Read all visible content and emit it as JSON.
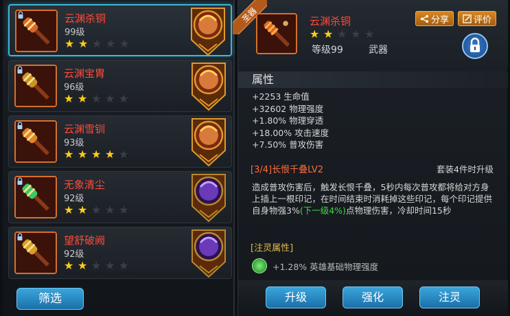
{
  "items": [
    {
      "name": "云渊杀铜",
      "level": "99级",
      "stars": 2,
      "selected": true,
      "portrait": "gold"
    },
    {
      "name": "云渊宝胄",
      "level": "96级",
      "stars": 2,
      "selected": false,
      "portrait": "gold"
    },
    {
      "name": "云渊雪钏",
      "level": "93级",
      "stars": 4,
      "selected": false,
      "portrait": "gold"
    },
    {
      "name": "无象清尘",
      "level": "92级",
      "stars": 2,
      "selected": false,
      "portrait": "purple"
    },
    {
      "name": "望舒破阙",
      "level": "92级",
      "stars": 2,
      "selected": false,
      "portrait": "purple"
    }
  ],
  "filter_label": "筛选",
  "detail": {
    "ribbon": "圣器",
    "name": "云渊杀铜",
    "stars": 2,
    "level": "等级99",
    "type": "武器",
    "share_label": "分享",
    "review_label": "评价",
    "section_title": "属性",
    "attributes": [
      "+2253 生命值",
      "+32602 物理强度",
      "+1.80% 物理穿透",
      "+18.00% 攻击速度",
      "+7.50% 普攻伤害"
    ],
    "set_title": "[3/4]长恨千叠LV2",
    "set_requirement": "套装4件时升级",
    "set_desc_pre": "造成普攻伤害后，触发长恨千叠，5秒内每次普攻都将给对方身上插上一根印记，在时间结束时消耗掉这些印记，每个印记提供自身物强3%",
    "set_desc_next": "(下一级4%)",
    "set_desc_post": "点物理伤害，冷却时间15秒",
    "spirit_title": "[注灵属性]",
    "spirit_attr": "+1.28% 英雄基础物理强度"
  },
  "actions": {
    "upgrade": "升级",
    "enhance": "强化",
    "infuse": "注灵"
  },
  "colors": {
    "accent": "#3ab7d8",
    "name_red": "#ff4a3a",
    "star": "#ffcd1a",
    "button_blue": "#1b6fa8"
  }
}
